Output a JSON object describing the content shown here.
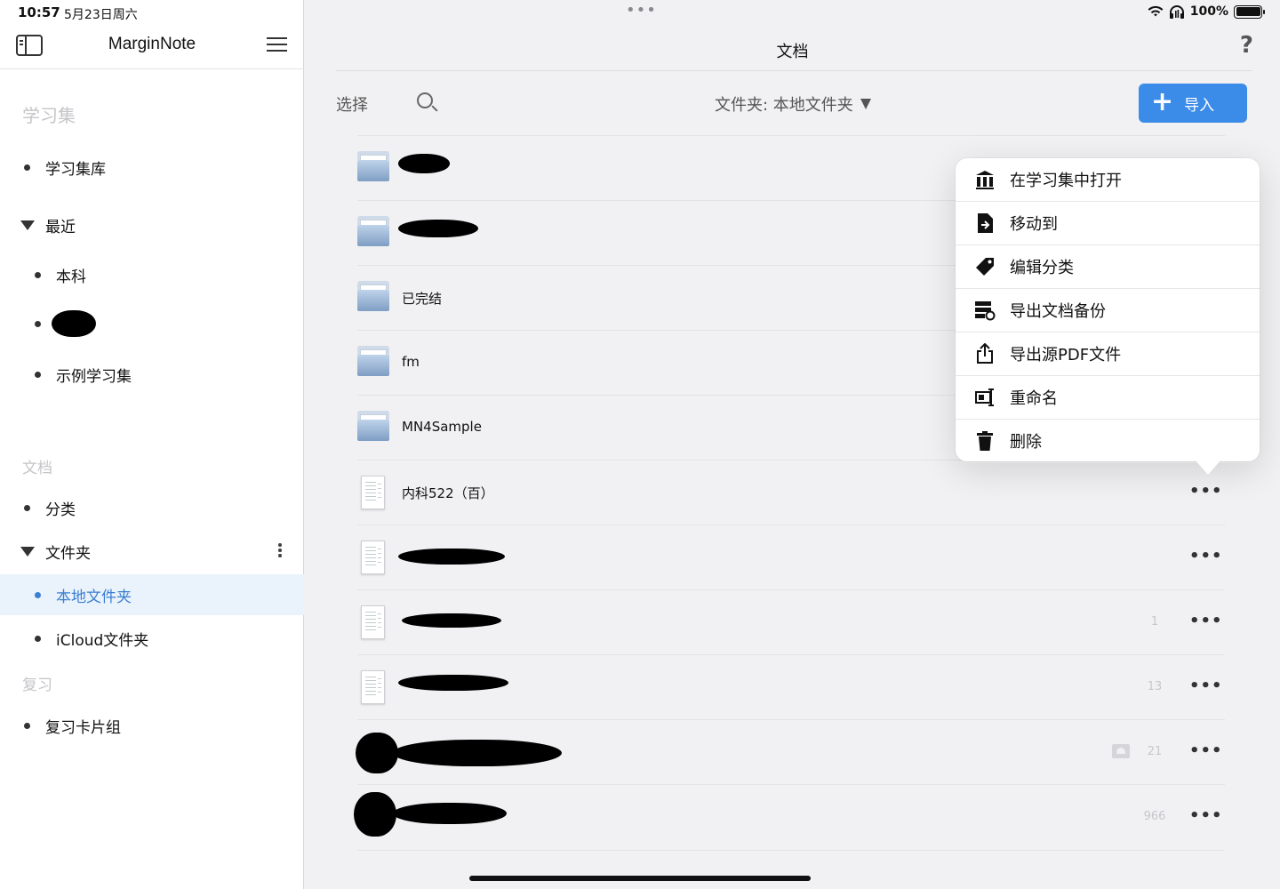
{
  "status_bar": {
    "time": "10:57",
    "date": "5月23日周六",
    "battery": "100%"
  },
  "sidebar": {
    "app_title": "MarginNote",
    "sections": {
      "study_sets": "学习集",
      "documents": "文档",
      "review": "复习"
    },
    "items": {
      "library": "学习集库",
      "recent": "最近",
      "recent_1": "本科",
      "recent_3": "示例学习集",
      "categories": "分类",
      "folders": "文件夹",
      "local_folder": "本地文件夹",
      "icloud_folder": "iCloud文件夹",
      "review_decks": "复习卡片组"
    }
  },
  "main": {
    "title": "文档",
    "help": "?",
    "select_label": "选择",
    "folder_picker": "文件夹: 本地文件夹",
    "import_label": "导入",
    "rows": [
      {
        "type": "folder",
        "name": ""
      },
      {
        "type": "folder",
        "name": ""
      },
      {
        "type": "folder",
        "name": "已完结"
      },
      {
        "type": "folder",
        "name": "fm"
      },
      {
        "type": "folder",
        "name": "MN4Sample"
      },
      {
        "type": "doc",
        "name": "内科522（百）",
        "count": ""
      },
      {
        "type": "doc",
        "name": "",
        "count": ""
      },
      {
        "type": "doc",
        "name": "",
        "count": "1"
      },
      {
        "type": "doc",
        "name": "",
        "count": "13"
      },
      {
        "type": "doc",
        "name": "",
        "count": "21"
      },
      {
        "type": "doc",
        "name": "",
        "count": "966"
      }
    ],
    "more_glyph": "•••"
  },
  "popover": {
    "items": [
      {
        "label": "在学习集中打开",
        "icon": "library-icon"
      },
      {
        "label": "移动到",
        "icon": "move-doc-icon"
      },
      {
        "label": "编辑分类",
        "icon": "tag-icon"
      },
      {
        "label": "导出文档备份",
        "icon": "backup-icon"
      },
      {
        "label": "导出源PDF文件",
        "icon": "share-icon"
      },
      {
        "label": "重命名",
        "icon": "rename-icon"
      },
      {
        "label": "删除",
        "icon": "trash-icon"
      }
    ]
  }
}
